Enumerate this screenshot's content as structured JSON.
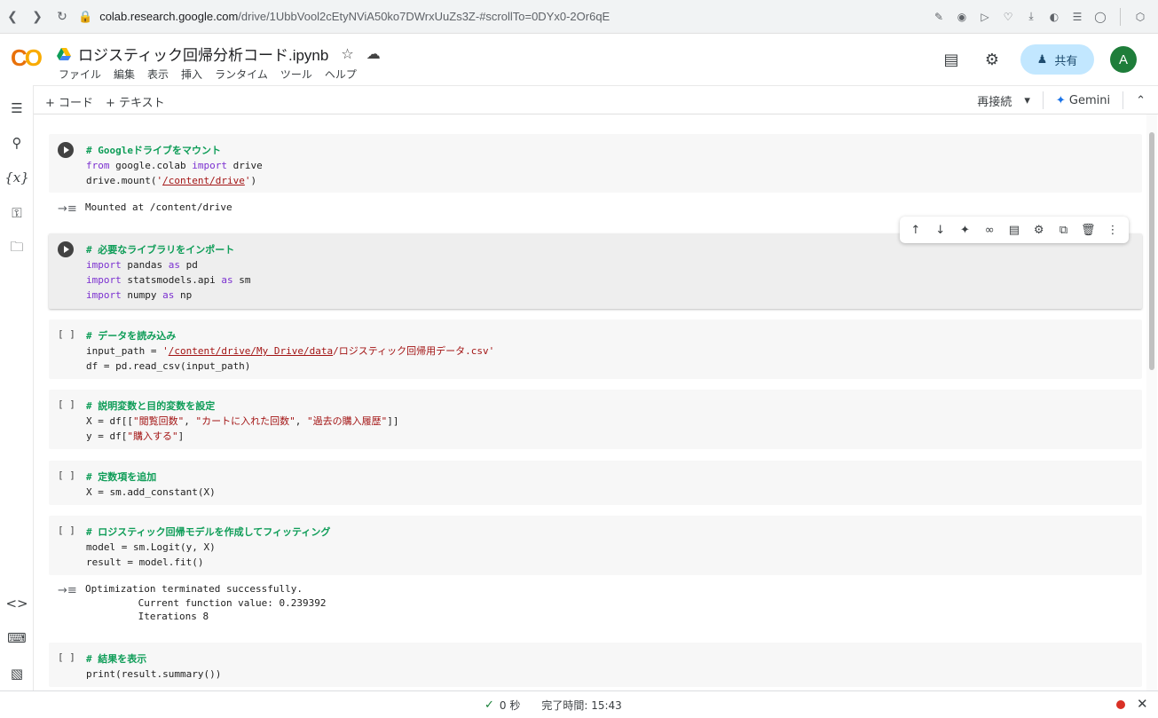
{
  "browser": {
    "url_host": "colab.research.google.com",
    "url_path": "/drive/1UbbVool2cEtyNViA50ko7DWrxUuZs3Z-#scrollTo=0DYx0-2Or6qE"
  },
  "header": {
    "logo": "CO",
    "title": "ロジスティック回帰分析コード.ipynb",
    "menu": [
      "ファイル",
      "編集",
      "表示",
      "挿入",
      "ランタイム",
      "ツール",
      "ヘルプ"
    ],
    "share_label": "共有",
    "avatar_initial": "A"
  },
  "toolbar": {
    "add_code": "+ コード",
    "add_text": "+ テキスト",
    "reconnect": "再接続",
    "gemini": "Gemini"
  },
  "cells": [
    {
      "state": "run",
      "lines": [
        "# Googleドライブをマウント",
        "from google.colab import drive",
        "drive.mount('/content/drive')"
      ],
      "output": [
        "Mounted at /content/drive"
      ]
    },
    {
      "state": "run",
      "lines": [
        "# 必要なライブラリをインポート",
        "import pandas as pd",
        "import statsmodels.api as sm",
        "import numpy as np"
      ]
    },
    {
      "state": "[ ]",
      "lines": [
        "# データを読み込み",
        "input_path = '/content/drive/My Drive/data/ロジスティック回帰用データ.csv'",
        "df = pd.read_csv(input_path)"
      ]
    },
    {
      "state": "[ ]",
      "lines": [
        "# 説明変数と目的変数を設定",
        "X = df[[\"閲覧回数\", \"カートに入れた回数\", \"過去の購入履歴\"]]",
        "y = df[\"購入する\"]"
      ]
    },
    {
      "state": "[ ]",
      "lines": [
        "# 定数項を追加",
        "X = sm.add_constant(X)"
      ]
    },
    {
      "state": "[ ]",
      "lines": [
        "# ロジスティック回帰モデルを作成してフィッティング",
        "model = sm.Logit(y, X)",
        "result = model.fit()"
      ],
      "output": [
        "Optimization terminated successfully.",
        "         Current function value: 0.239392",
        "         Iterations 8"
      ]
    },
    {
      "state": "[ ]",
      "lines": [
        "# 結果を表示",
        "print(result.summary())"
      ]
    }
  ],
  "status": {
    "elapsed": "0 秒",
    "completed": "完了時間: 15:43"
  },
  "colors": {
    "comment": "#0f9d58",
    "keyword": "#7b30d0",
    "string": "#a31515",
    "share_bg": "#c2e7ff",
    "avatar_bg": "#1e7d3a"
  }
}
